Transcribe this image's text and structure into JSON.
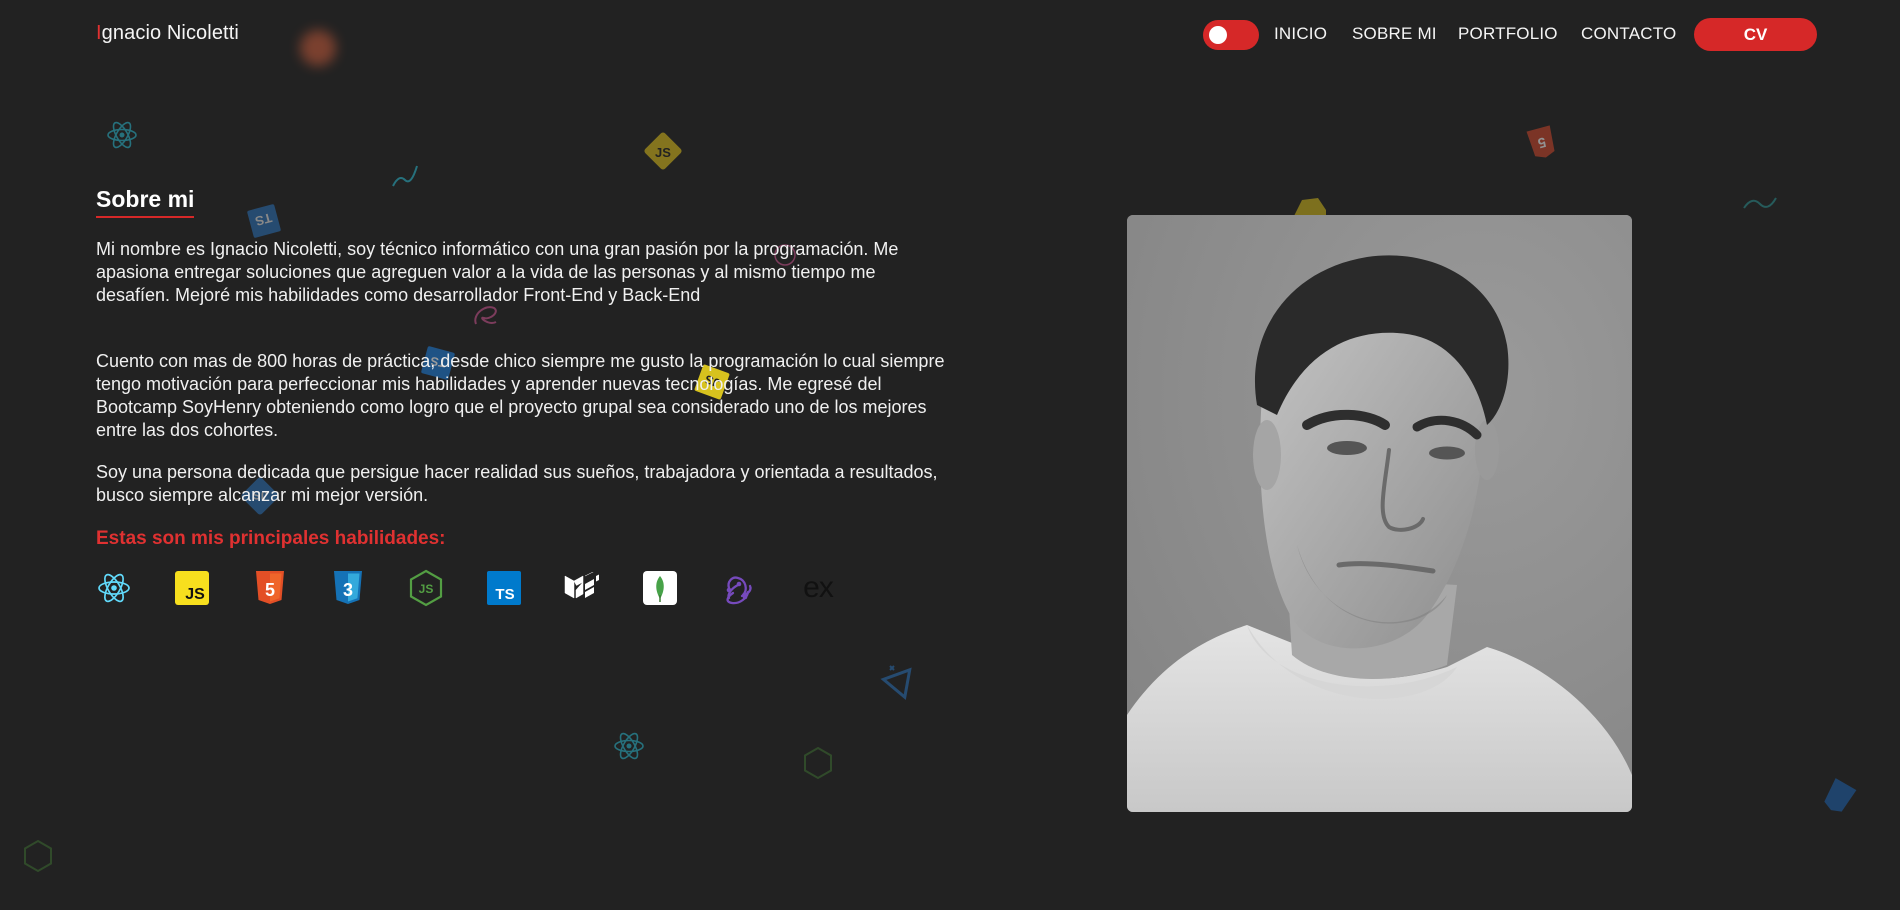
{
  "brand": {
    "first_letter": "I",
    "rest": "gnacio Nicoletti"
  },
  "nav": {
    "links": [
      "INICIO",
      "SOBRE MI",
      "PORTFOLIO",
      "CONTACTO"
    ],
    "cv_label": "CV"
  },
  "theme_toggle": {
    "state": "on"
  },
  "about": {
    "title": "Sobre mi",
    "paragraphs": [
      "Mi nombre es Ignacio Nicoletti, soy técnico informático con una gran pasión por la programación. Me apasiona entregar soluciones que agreguen valor a la vida de las personas y al mismo tiempo me desafíen. Mejoré mis habilidades como desarrollador Front-End y Back-End",
      "Cuento con mas de 800 horas de práctica, desde chico siempre me gusto la programación lo cual siempre tengo motivación para perfeccionar mis habilidades y aprender nuevas tecnologías. Me egresé del Bootcamp SoyHenry obteniendo como logro que el proyecto grupal sea considerado uno de los mejores entre las dos cohortes.",
      "Soy una persona dedicada que persigue hacer realidad sus sueños, trabajadora y orientada a resultados, busco siempre alcanzar mi mejor versión."
    ],
    "skills_title": "Estas son mis principales habilidades:",
    "skills": [
      {
        "icon": "react-icon",
        "label": "",
        "color": "#61dafb"
      },
      {
        "icon": "javascript-icon",
        "label": "JS",
        "color": "#f7df1e"
      },
      {
        "icon": "html5-icon",
        "label": "5",
        "color": "#e34f26"
      },
      {
        "icon": "css3-icon",
        "label": "3",
        "color": "#1572b6"
      },
      {
        "icon": "nodejs-icon",
        "label": "JS",
        "color": "#539e43"
      },
      {
        "icon": "typescript-icon",
        "label": "TS",
        "color": "#007acc"
      },
      {
        "icon": "mui-icon",
        "label": "",
        "color": "#ffffff"
      },
      {
        "icon": "mongodb-icon",
        "label": "",
        "color": "#47a248"
      },
      {
        "icon": "redux-icon",
        "label": "",
        "color": "#764abc"
      },
      {
        "icon": "express-icon",
        "label": "ex",
        "color": "#111111"
      }
    ]
  },
  "colors": {
    "accent": "#d62828",
    "background": "#222222",
    "text": "#f2f2f2"
  }
}
